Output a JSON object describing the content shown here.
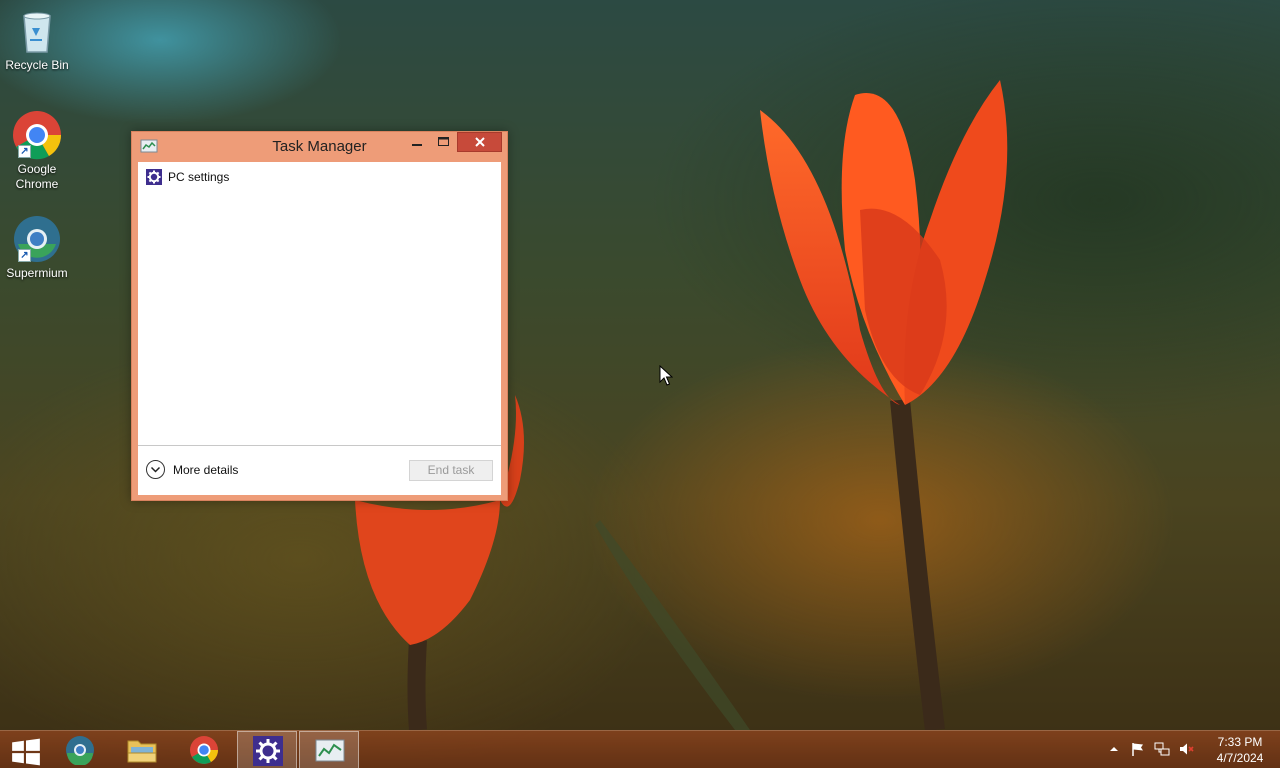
{
  "desktop": {
    "icons": [
      {
        "label": "Recycle Bin",
        "icon": "recycle-bin-icon"
      },
      {
        "label": "Google Chrome",
        "icon": "chrome-icon"
      },
      {
        "label": "Supermium",
        "icon": "supermium-icon"
      }
    ]
  },
  "task_manager": {
    "title": "Task Manager",
    "title_icon": "task-manager-icon",
    "buttons": {
      "minimize": "minimize-icon",
      "maximize": "maximize-icon",
      "close": "close-icon"
    },
    "processes": [
      {
        "name": "PC settings",
        "icon": "pc-settings-gear-icon"
      }
    ],
    "more_details_label": "More details",
    "end_task_label": "End task"
  },
  "taskbar": {
    "items": [
      {
        "name": "start",
        "icon": "windows-logo-icon"
      },
      {
        "name": "supermium",
        "icon": "supermium-icon"
      },
      {
        "name": "file-explorer",
        "icon": "folder-icon"
      },
      {
        "name": "chrome",
        "icon": "chrome-icon"
      },
      {
        "name": "pc-settings",
        "icon": "gear-icon",
        "active": true
      },
      {
        "name": "task-manager",
        "icon": "task-manager-icon",
        "active": true
      }
    ],
    "tray_icons": [
      "show-hidden-icons-arrow",
      "action-center-flag-icon",
      "network-icon",
      "volume-muted-icon"
    ],
    "clock": {
      "time": "7:33 PM",
      "date": "4/7/2024"
    }
  },
  "colors": {
    "window_frame": "#ee9c78",
    "close_button": "#c74a3a",
    "taskbar": "#8a4520",
    "settings_purple": "#3e2e8e"
  }
}
